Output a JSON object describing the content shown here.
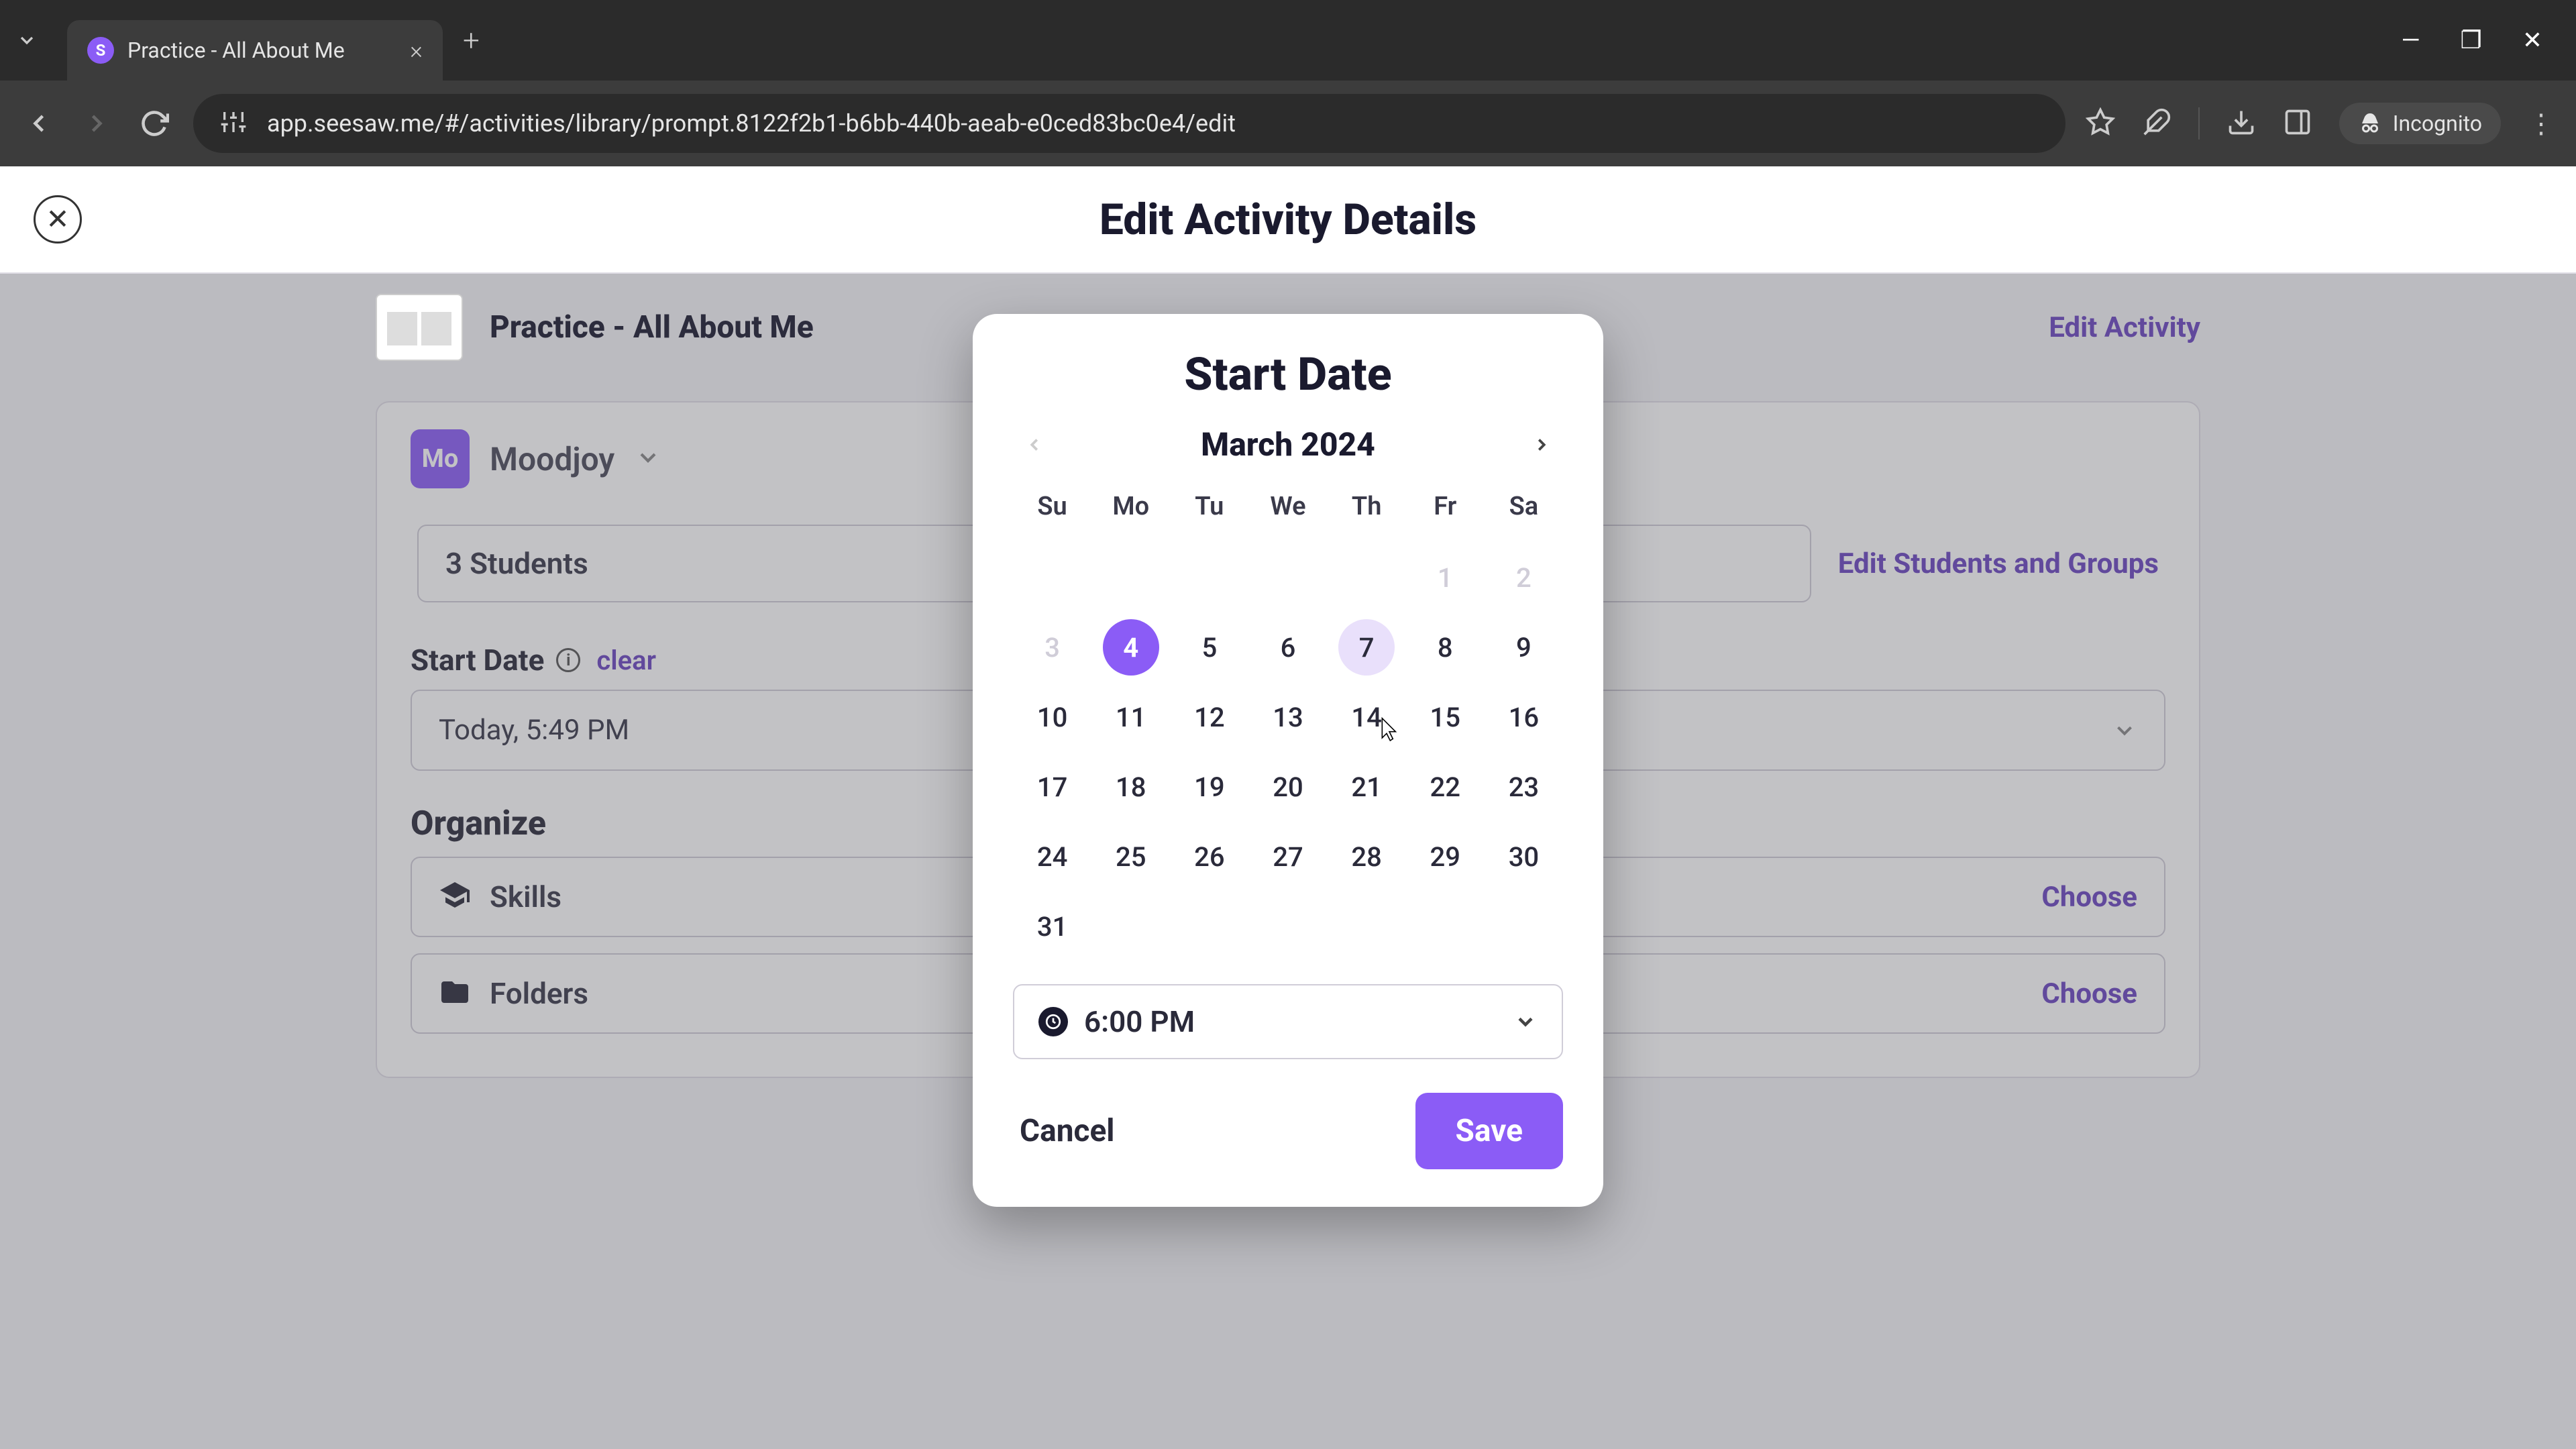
{
  "browser": {
    "tab_title": "Practice - All About Me",
    "url": "app.seesaw.me/#/activities/library/prompt.8122f2b1-b6bb-440b-aeab-e0ced83bc0e4/edit",
    "incognito_label": "Incognito",
    "favicon_letter": "S"
  },
  "page": {
    "header_title": "Edit Activity Details",
    "activity_name": "Practice - All About Me",
    "edit_activity_label": "Edit Activity",
    "class_avatar": "Mo",
    "class_name": "Moodjoy",
    "students_count_text": "3 Students",
    "edit_students_label": "Edit Students and Groups",
    "start_date_label": "Start Date",
    "clear_label": "clear",
    "start_date_value": "Today, 5:49 PM",
    "organize_label": "Organize",
    "skills_label": "Skills",
    "folders_label": "Folders",
    "choose_label": "Choose",
    "save_label": "Save"
  },
  "modal": {
    "title": "Start Date",
    "month_label": "March 2024",
    "weekdays": [
      "Su",
      "Mo",
      "Tu",
      "We",
      "Th",
      "Fr",
      "Sa"
    ],
    "weeks": [
      [
        {
          "n": "",
          "state": ""
        },
        {
          "n": "",
          "state": ""
        },
        {
          "n": "",
          "state": ""
        },
        {
          "n": "",
          "state": ""
        },
        {
          "n": "",
          "state": ""
        },
        {
          "n": "1",
          "state": "disabled"
        },
        {
          "n": "2",
          "state": "disabled"
        }
      ],
      [
        {
          "n": "3",
          "state": "disabled"
        },
        {
          "n": "4",
          "state": "selected"
        },
        {
          "n": "5",
          "state": ""
        },
        {
          "n": "6",
          "state": ""
        },
        {
          "n": "7",
          "state": "hover"
        },
        {
          "n": "8",
          "state": ""
        },
        {
          "n": "9",
          "state": ""
        }
      ],
      [
        {
          "n": "10",
          "state": ""
        },
        {
          "n": "11",
          "state": ""
        },
        {
          "n": "12",
          "state": ""
        },
        {
          "n": "13",
          "state": ""
        },
        {
          "n": "14",
          "state": ""
        },
        {
          "n": "15",
          "state": ""
        },
        {
          "n": "16",
          "state": ""
        }
      ],
      [
        {
          "n": "17",
          "state": ""
        },
        {
          "n": "18",
          "state": ""
        },
        {
          "n": "19",
          "state": ""
        },
        {
          "n": "20",
          "state": ""
        },
        {
          "n": "21",
          "state": ""
        },
        {
          "n": "22",
          "state": ""
        },
        {
          "n": "23",
          "state": ""
        }
      ],
      [
        {
          "n": "24",
          "state": ""
        },
        {
          "n": "25",
          "state": ""
        },
        {
          "n": "26",
          "state": ""
        },
        {
          "n": "27",
          "state": ""
        },
        {
          "n": "28",
          "state": ""
        },
        {
          "n": "29",
          "state": ""
        },
        {
          "n": "30",
          "state": ""
        }
      ],
      [
        {
          "n": "31",
          "state": ""
        },
        {
          "n": "",
          "state": ""
        },
        {
          "n": "",
          "state": ""
        },
        {
          "n": "",
          "state": ""
        },
        {
          "n": "",
          "state": ""
        },
        {
          "n": "",
          "state": ""
        },
        {
          "n": "",
          "state": ""
        }
      ]
    ],
    "time_value": "6:00 PM",
    "cancel_label": "Cancel",
    "save_label": "Save"
  },
  "colors": {
    "accent": "#8b5cf6",
    "accent_dark": "#6b46c1"
  }
}
